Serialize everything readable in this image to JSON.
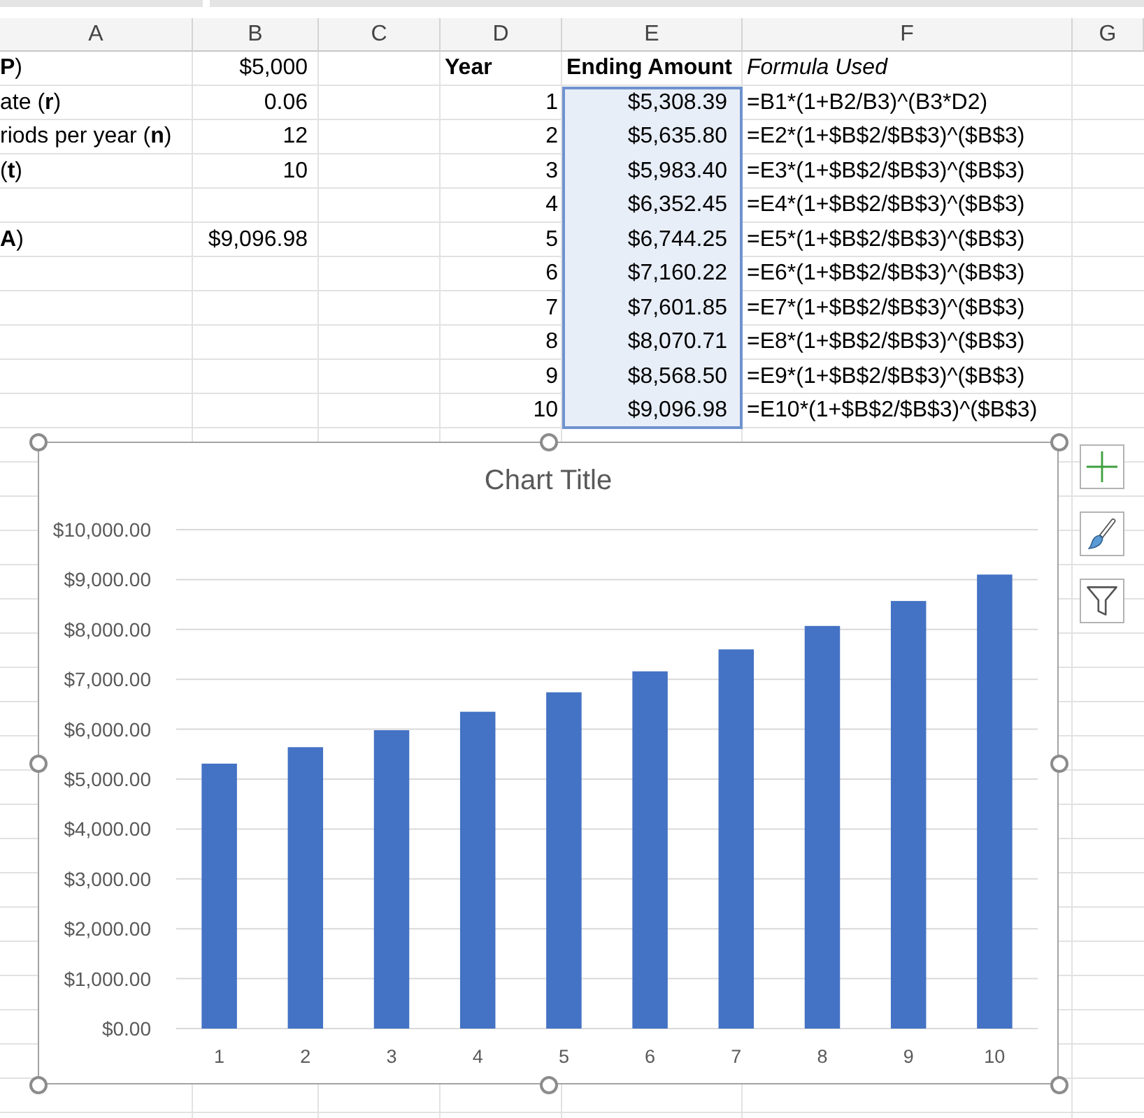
{
  "columns": [
    "A",
    "B",
    "C",
    "D",
    "E",
    "F",
    "G"
  ],
  "rows": [
    {
      "kind": "heading",
      "a": "**P**)",
      "b": "$5,000",
      "d": "Year",
      "e": {
        "text": "Ending Amount",
        "selected": false
      },
      "f": "Formula Used"
    },
    {
      "kind": "data",
      "a": "ate (**r**)",
      "b": "0.06",
      "d": "1",
      "e": {
        "text": "$5,308.39",
        "selected": true
      },
      "f": "=B1*(1+B2/B3)^(B3*D2)"
    },
    {
      "kind": "data",
      "a": "riods per year (**n**)",
      "b": "12",
      "d": "2",
      "e": {
        "text": "$5,635.80",
        "selected": true
      },
      "f": "=E2*(1+$B$2/$B$3)^($B$3)"
    },
    {
      "kind": "data",
      "a": "(**t**)",
      "b": "10",
      "d": "3",
      "e": {
        "text": "$5,983.40",
        "selected": true
      },
      "f": "=E3*(1+$B$2/$B$3)^($B$3)"
    },
    {
      "kind": "data",
      "d": "4",
      "e": {
        "text": "$6,352.45",
        "selected": true
      },
      "f": "=E4*(1+$B$2/$B$3)^($B$3)"
    },
    {
      "kind": "data",
      "a": "**A**)",
      "b": "$9,096.98",
      "d": "5",
      "e": {
        "text": "$6,744.25",
        "selected": true
      },
      "f": "=E5*(1+$B$2/$B$3)^($B$3)"
    },
    {
      "kind": "data",
      "d": "6",
      "e": {
        "text": "$7,160.22",
        "selected": true
      },
      "f": "=E6*(1+$B$2/$B$3)^($B$3)"
    },
    {
      "kind": "data",
      "d": "7",
      "e": {
        "text": "$7,601.85",
        "selected": true
      },
      "f": "=E7*(1+$B$2/$B$3)^($B$3)"
    },
    {
      "kind": "data",
      "d": "8",
      "e": {
        "text": "$8,070.71",
        "selected": true
      },
      "f": "=E8*(1+$B$2/$B$3)^($B$3)"
    },
    {
      "kind": "data",
      "d": "9",
      "e": {
        "text": "$8,568.50",
        "selected": true
      },
      "f": "=E9*(1+$B$2/$B$3)^($B$3)"
    },
    {
      "kind": "data",
      "d": "10",
      "e": {
        "text": "$9,096.98",
        "selected": true
      },
      "f": "=E10*(1+$B$2/$B$3)^($B$3)"
    }
  ],
  "chart": {
    "selected": true,
    "chart_data": {
      "type": "bar",
      "title": "Chart Title",
      "grid": true,
      "categories": [
        "1",
        "2",
        "3",
        "4",
        "5",
        "6",
        "7",
        "8",
        "9",
        "10"
      ],
      "series": [
        {
          "color": "#4472c4",
          "values": [
            5310,
            5640,
            5980,
            6350,
            6740,
            7160,
            7600,
            8070,
            8570,
            9100
          ]
        }
      ],
      "ylim": [
        0,
        10000
      ],
      "yticks": [
        {
          "value": 0,
          "label": "$0.00"
        },
        {
          "value": 1000,
          "label": "$1,000.00"
        },
        {
          "value": 2000,
          "label": "$2,000.00"
        },
        {
          "value": 3000,
          "label": "$3,000.00"
        },
        {
          "value": 4000,
          "label": "$4,000.00"
        },
        {
          "value": 5000,
          "label": "$5,000.00"
        },
        {
          "value": 6000,
          "label": "$6,000.00"
        },
        {
          "value": 7000,
          "label": "$7,000.00"
        },
        {
          "value": 8000,
          "label": "$8,000.00"
        },
        {
          "value": 9000,
          "label": "$9,000.00"
        },
        {
          "value": 10000,
          "label": "$10,000.00"
        }
      ]
    }
  }
}
